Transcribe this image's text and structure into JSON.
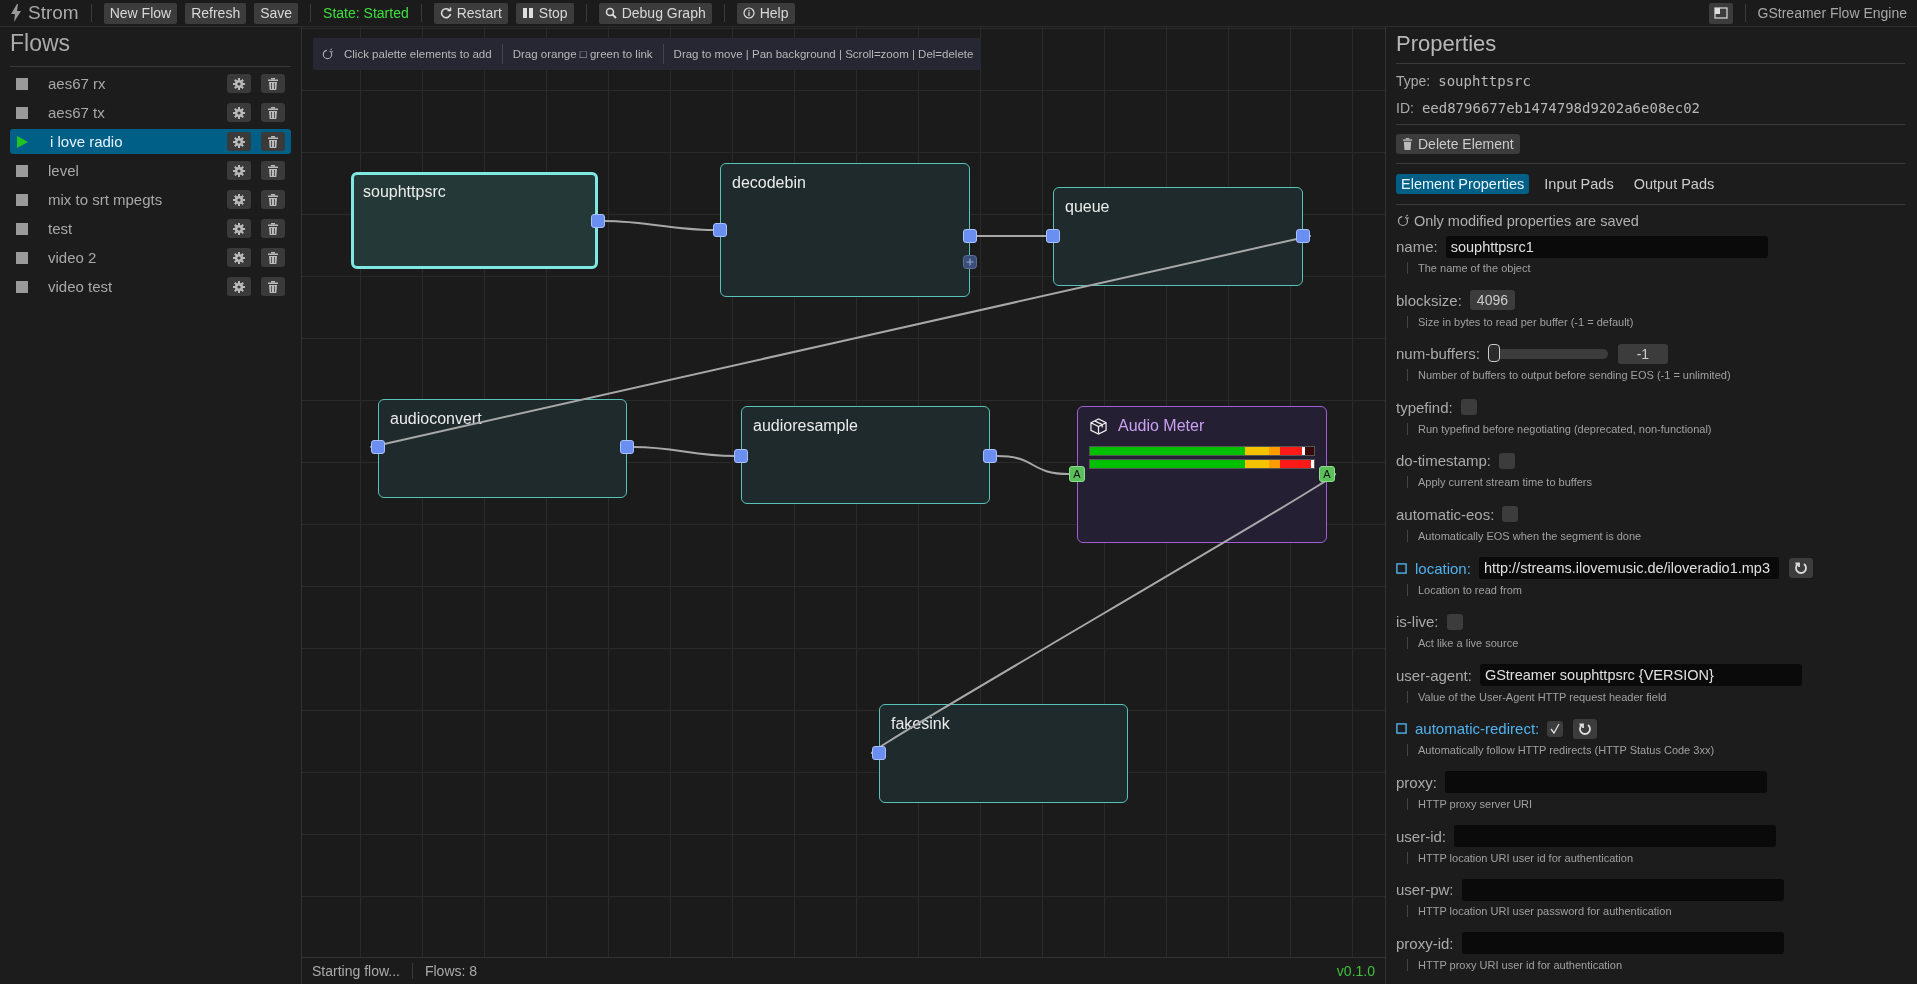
{
  "topbar": {
    "app_title": "Strom",
    "file_buttons": [
      {
        "label": "New Flow"
      },
      {
        "label": "Refresh"
      },
      {
        "label": "Save"
      }
    ],
    "state": "State: Started",
    "control_buttons": [
      {
        "label": "Restart",
        "kind": "restart"
      },
      {
        "label": "Stop",
        "kind": "stop"
      },
      {
        "label": "Debug Graph",
        "kind": "debug"
      },
      {
        "label": "Help",
        "kind": "help"
      }
    ],
    "engine_name": "GStreamer Flow Engine"
  },
  "sidebar": {
    "title": "Flows",
    "items": [
      {
        "name": "aes67 rx",
        "running": false,
        "selected": false
      },
      {
        "name": "aes67 tx",
        "running": false,
        "selected": false
      },
      {
        "name": "i love radio",
        "running": true,
        "selected": true
      },
      {
        "name": "level",
        "running": false,
        "selected": false
      },
      {
        "name": "mix to srt mpegts",
        "running": false,
        "selected": false
      },
      {
        "name": "test",
        "running": false,
        "selected": false
      },
      {
        "name": "video 2",
        "running": false,
        "selected": false
      },
      {
        "name": "video test",
        "running": false,
        "selected": false
      }
    ]
  },
  "canvas": {
    "hints": [
      "Click palette elements to add",
      "Drag orange □ green to link",
      "Drag to move | Pan background | Scroll=zoom | Del=delete"
    ],
    "nodes": [
      {
        "title": "souphttpsrc",
        "kind": "element",
        "selected": true
      },
      {
        "title": "decodebin",
        "kind": "element",
        "selected": false
      },
      {
        "title": "queue",
        "kind": "element",
        "selected": false
      },
      {
        "title": "audioconvert",
        "kind": "element",
        "selected": false
      },
      {
        "title": "audioresample",
        "kind": "element",
        "selected": false
      },
      {
        "title": "Audio Meter",
        "kind": "meter",
        "selected": false,
        "input_pad_label": "A",
        "output_pad_label": "A",
        "channels": [
          {
            "level": 0.96
          },
          {
            "level": 1.0
          }
        ]
      },
      {
        "title": "fakesink",
        "kind": "element",
        "selected": false
      }
    ]
  },
  "status_bar": {
    "message": "Starting flow...",
    "flow_count": "Flows: 8",
    "version": "v0.1.0"
  },
  "properties": {
    "title": "Properties",
    "type_label": "Type:",
    "type": "souphttpsrc",
    "id_label": "ID:",
    "id": "eed8796677eb1474798d9202a6e08ec02",
    "delete_button": "Delete Element",
    "tabs": [
      {
        "label": "Element Properties",
        "selected": true
      },
      {
        "label": "Input Pads",
        "selected": false
      },
      {
        "label": "Output Pads",
        "selected": false
      }
    ],
    "note": "Only modified properties are saved",
    "items": [
      {
        "label": "name:",
        "kind": "text",
        "modified": false,
        "value": "souphttpsrc1",
        "description": "The name of the object"
      },
      {
        "label": "blocksize:",
        "kind": "number",
        "modified": false,
        "value": "4096",
        "description": "Size in bytes to read per buffer (-1 = default)"
      },
      {
        "label": "num-buffers:",
        "kind": "slider",
        "modified": false,
        "level": 0,
        "value": "-1",
        "description": "Number of buffers to output before sending EOS (-1 = unlimited)"
      },
      {
        "label": "typefind:",
        "kind": "checkbox",
        "modified": false,
        "checked": false,
        "description": "Run typefind before negotiating (deprecated, non-functional)"
      },
      {
        "label": "do-timestamp:",
        "kind": "checkbox",
        "modified": false,
        "checked": false,
        "description": "Apply current stream time to buffers"
      },
      {
        "label": "automatic-eos:",
        "kind": "checkbox",
        "modified": false,
        "checked": false,
        "description": "Automatically EOS when the segment is done"
      },
      {
        "label": "location:",
        "kind": "text",
        "modified": true,
        "value": "http://streams.ilovemusic.de/iloveradio1.mp3",
        "description": "Location to read from"
      },
      {
        "label": "is-live:",
        "kind": "checkbox",
        "modified": false,
        "checked": false,
        "description": "Act like a live source"
      },
      {
        "label": "user-agent:",
        "kind": "text",
        "modified": false,
        "value": "GStreamer souphttpsrc {VERSION}",
        "description": "Value of the User-Agent HTTP request header field"
      },
      {
        "label": "automatic-redirect:",
        "kind": "checkbox",
        "modified": true,
        "checked": true,
        "description": "Automatically follow HTTP redirects (HTTP Status Code 3xx)"
      },
      {
        "label": "proxy:",
        "kind": "text",
        "modified": false,
        "description": "HTTP proxy server URI"
      },
      {
        "label": "user-id:",
        "kind": "text",
        "modified": false,
        "description": "HTTP location URI user id for authentication"
      },
      {
        "label": "user-pw:",
        "kind": "text",
        "modified": false,
        "description": "HTTP location URI user password for authentication"
      },
      {
        "label": "proxy-id:",
        "kind": "text",
        "modified": false,
        "description": "HTTP proxy URI user id for authentication"
      }
    ]
  }
}
